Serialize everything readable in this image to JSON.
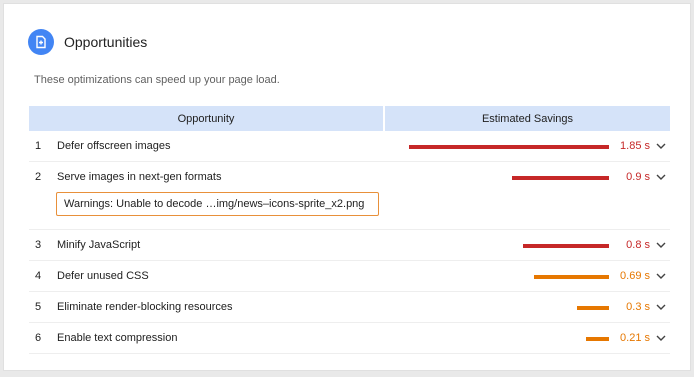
{
  "header": {
    "title": "Opportunities",
    "icon": "opportunity-icon",
    "icon_color": "#4285f4"
  },
  "description": "These optimizations can speed up your page load.",
  "table": {
    "col_opportunity": "Opportunity",
    "col_savings": "Estimated Savings",
    "header_bg": "#d5e3f9"
  },
  "colors": {
    "fail": "#c62828",
    "average": "#e67700"
  },
  "rows": [
    {
      "num": "1",
      "title": "Defer offscreen images",
      "savings": "1.85 s",
      "savings_value": 1.85,
      "status": "fail"
    },
    {
      "num": "2",
      "title": "Serve images in next-gen formats",
      "savings": "0.9 s",
      "savings_value": 0.9,
      "status": "fail",
      "warning": "Warnings: Unable to decode …img/news–icons-sprite_x2.png"
    },
    {
      "num": "3",
      "title": "Minify JavaScript",
      "savings": "0.8 s",
      "savings_value": 0.8,
      "status": "fail"
    },
    {
      "num": "4",
      "title": "Defer unused CSS",
      "savings": "0.69 s",
      "savings_value": 0.69,
      "status": "average"
    },
    {
      "num": "5",
      "title": "Eliminate render-blocking resources",
      "savings": "0.3 s",
      "savings_value": 0.3,
      "status": "average"
    },
    {
      "num": "6",
      "title": "Enable text compression",
      "savings": "0.21 s",
      "savings_value": 0.21,
      "status": "average"
    }
  ]
}
